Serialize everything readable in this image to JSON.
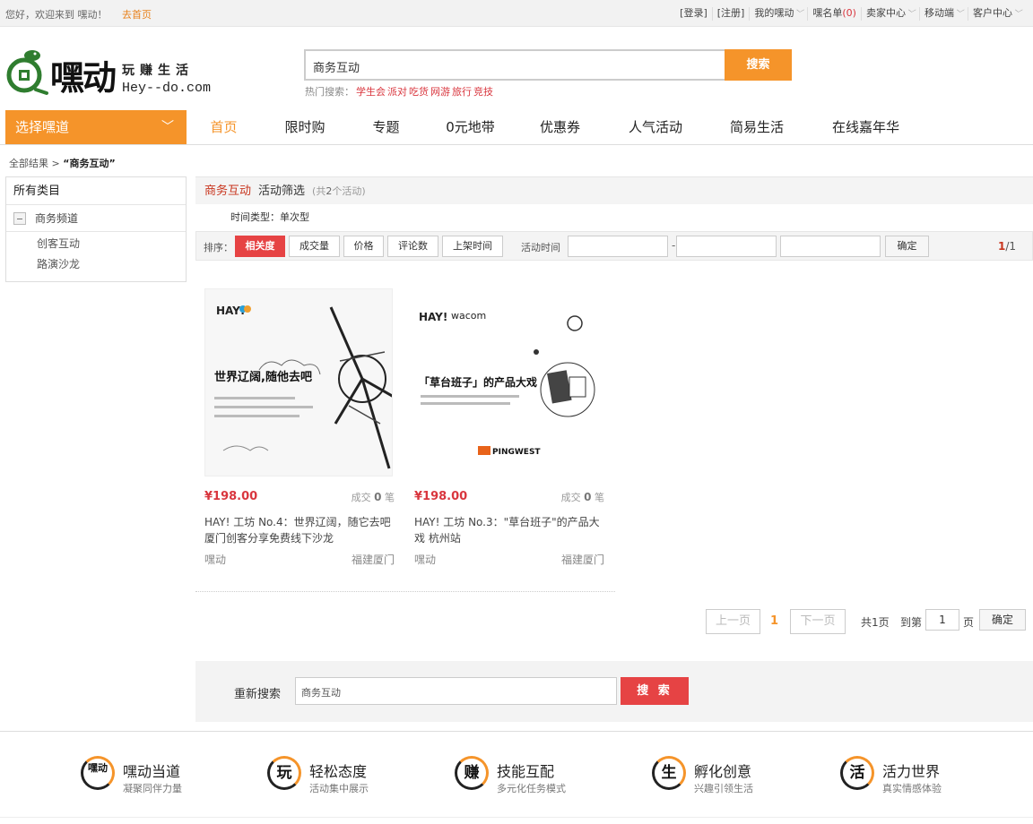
{
  "topbar": {
    "welcome": "您好，欢迎来到 嘿动！",
    "home_link": "去首页",
    "links": [
      {
        "label": "[登录]",
        "caret": false
      },
      {
        "label": "[注册]",
        "caret": false
      },
      {
        "label": "我的嘿动",
        "caret": true
      },
      {
        "label": "嘿名单",
        "count": "(0)",
        "caret": false
      },
      {
        "label": "卖家中心",
        "caret": true
      },
      {
        "label": "移动端",
        "caret": true
      },
      {
        "label": "客户中心",
        "caret": true
      }
    ]
  },
  "logo": {
    "brand_cn": "嘿动",
    "slogan": "玩赚生活",
    "domain": "Hey--do.com"
  },
  "search": {
    "value": "商务互动",
    "button": "搜索",
    "hot_label": "热门搜索：",
    "hot_keywords": [
      "学生会",
      "派对",
      "吃货",
      "网游",
      "旅行",
      "竞技"
    ]
  },
  "nav": {
    "category_button": "选择嘿道",
    "items": [
      "首页",
      "限时购",
      "专题",
      "0元地带",
      "优惠券",
      "人气活动",
      "简易生活",
      "在线嘉年华"
    ],
    "active_index": 0
  },
  "breadcrumb": {
    "root": "全部结果",
    "separator": ">",
    "current": "“商务互动”"
  },
  "sidebar": {
    "header": "所有类目",
    "channel": "商务频道",
    "subitems": [
      "创客互动",
      "路演沙龙"
    ]
  },
  "filter": {
    "tag": "商务互动",
    "title": "活动筛选",
    "count_prefix": "(共",
    "count": "2",
    "count_suffix": "个活动)",
    "time_type": "时间类型：单次型",
    "sort_label": "排序：",
    "sort_options": [
      "相关度",
      "成交量",
      "价格",
      "评论数",
      "上架时间"
    ],
    "active_sort": 0,
    "time_label": "活动时间",
    "dash": "-",
    "confirm": "确定",
    "page_current": "1",
    "page_total": "/1"
  },
  "products": [
    {
      "price": "¥198.00",
      "sold_label": "成交",
      "sold_count": "0",
      "sold_unit": "笔",
      "title": "HAY! 工坊 No.4：世界辽阔，随它去吧 厦门创客分享免费线下沙龙",
      "org": "嘿动",
      "location": "福建厦门",
      "image_text": "世界辽阔,随他去吧",
      "image_brand": "HAY!"
    },
    {
      "price": "¥198.00",
      "sold_label": "成交",
      "sold_count": "0",
      "sold_unit": "笔",
      "title": "HAY! 工坊 No.3：\"草台班子\"的产品大戏 杭州站",
      "org": "嘿动",
      "location": "福建厦门",
      "image_text": "「草台班子」的产品大戏",
      "image_brand": "HAY!",
      "image_partner": "wacom",
      "image_sponsor": "PINGWEST"
    }
  ],
  "pager": {
    "prev": "上一页",
    "current": "1",
    "next": "下一页",
    "total": "共1页",
    "goto": "到第",
    "goto_value": "1",
    "page_unit": "页",
    "confirm": "确定"
  },
  "research": {
    "label": "重新搜索",
    "value": "商务互动",
    "button": "搜 索"
  },
  "features": [
    {
      "icon": "嘿动",
      "title": "嘿动当道",
      "subtitle": "凝聚同伴力量"
    },
    {
      "icon": "玩",
      "title": "轻松态度",
      "subtitle": "活动集中展示"
    },
    {
      "icon": "赚",
      "title": "技能互配",
      "subtitle": "多元化任务模式"
    },
    {
      "icon": "生",
      "title": "孵化创意",
      "subtitle": "兴趣引领生活"
    },
    {
      "icon": "活",
      "title": "活力世界",
      "subtitle": "真实情感体验"
    }
  ],
  "colors": {
    "accent_orange": "#f5942a",
    "accent_red": "#e64344",
    "price_red": "#d9363e"
  }
}
